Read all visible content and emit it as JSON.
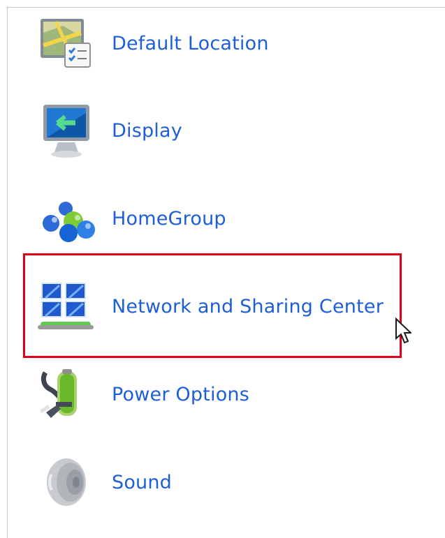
{
  "items": [
    {
      "label": "Default Location",
      "icon": "default-location-icon"
    },
    {
      "label": "Display",
      "icon": "display-icon"
    },
    {
      "label": "HomeGroup",
      "icon": "homegroup-icon"
    },
    {
      "label": "Network and Sharing Center",
      "icon": "network-and-sharing-center-icon"
    },
    {
      "label": "Power Options",
      "icon": "power-options-icon"
    },
    {
      "label": "Sound",
      "icon": "sound-icon"
    }
  ],
  "highlight_color": "#e3001b",
  "link_color": "#1e5ed6"
}
